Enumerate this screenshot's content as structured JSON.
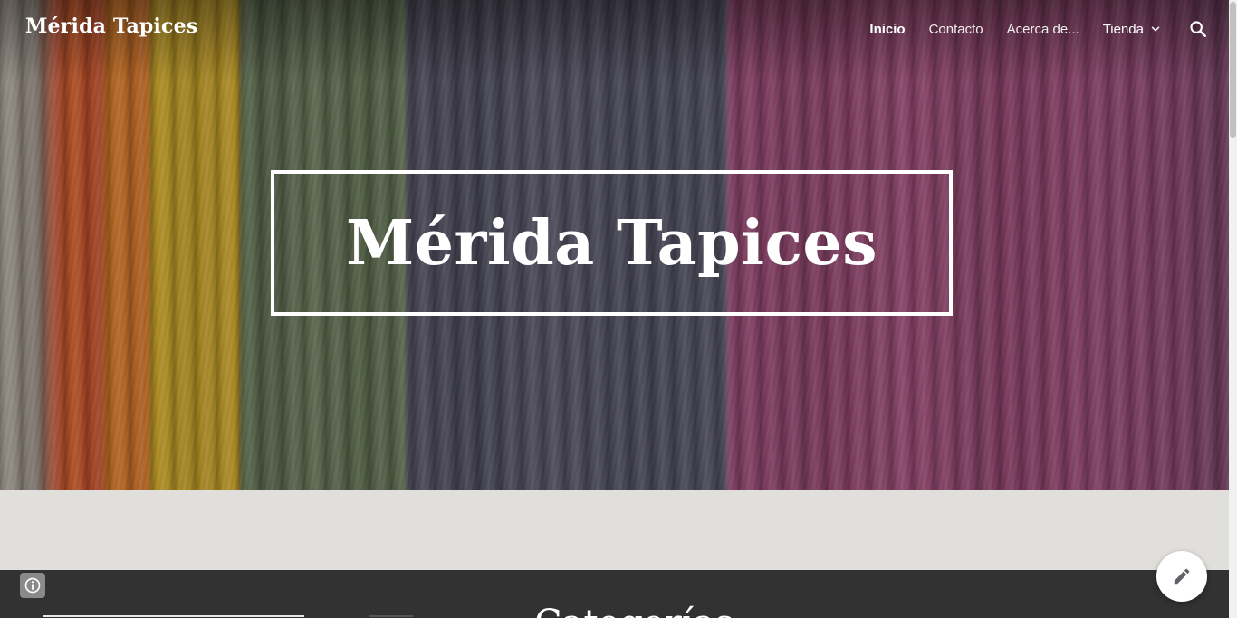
{
  "header": {
    "site_title": "Mérida Tapices",
    "nav": {
      "items": [
        {
          "label": "Inicio",
          "active": true
        },
        {
          "label": "Contacto",
          "active": false
        },
        {
          "label": "Acerca de...",
          "active": false
        }
      ],
      "dropdown_label": "Tienda",
      "dropdown_icon": "chevron-down-icon",
      "search_icon": "search-icon"
    }
  },
  "hero": {
    "title": "Mérida Tapices"
  },
  "section": {
    "heading": "Categorías"
  },
  "floating": {
    "info_icon": "info-icon",
    "edit_icon": "pencil-icon"
  },
  "colors": {
    "dark_section": "#323232",
    "band": "#e0dfdc",
    "text_light": "#ffffff"
  }
}
